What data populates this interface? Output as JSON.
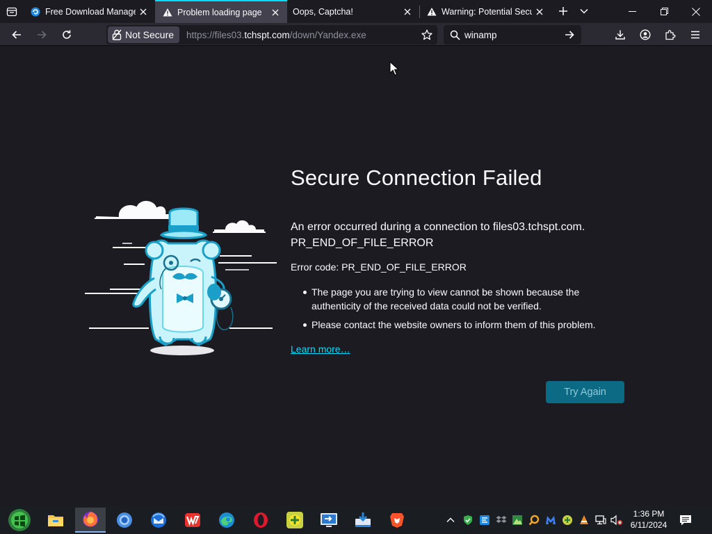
{
  "tabs": [
    {
      "label": "Free Download Manager",
      "icon": "fdm-icon",
      "selected": false
    },
    {
      "label": "Problem loading page",
      "icon": "warning-icon",
      "selected": true
    },
    {
      "label": "Oops, Captcha!",
      "icon": "none",
      "selected": false
    },
    {
      "label": "Warning: Potential Securi",
      "icon": "warning-icon",
      "selected": false
    }
  ],
  "navbar": {
    "security_label": "Not Secure",
    "url_prefix": "https://files03.",
    "url_host": "tchspt.com",
    "url_path": "/down/Yandex.exe",
    "search_value": "winamp"
  },
  "error_page": {
    "title": "Secure Connection Failed",
    "short_desc_line1": "An error occurred during a connection to files03.tchspt.com.",
    "short_desc_line2": "PR_END_OF_FILE_ERROR",
    "error_code": "Error code: PR_END_OF_FILE_ERROR",
    "reasons": [
      "The page you are trying to view cannot be shown because the authenticity of the received data could not be verified.",
      "Please contact the website owners to inform them of this problem."
    ],
    "learn_more": "Learn more…",
    "try_again": "Try Again"
  },
  "taskbar": {
    "apps": [
      "start-icon",
      "file-explorer-icon",
      "firefox-icon",
      "chromium-icon",
      "thunderbird-icon",
      "wps-office-icon",
      "edge-icon",
      "opera-icon",
      "game-icon",
      "remote-desktop-icon",
      "downloader-icon",
      "brave-icon"
    ],
    "active_app": "firefox-icon",
    "time": "1:36 PM",
    "date": "6/11/2024"
  },
  "colors": {
    "accent": "#00ddff",
    "page_bg": "#1c1b22",
    "toolbar_bg": "#2b2a33",
    "button_bg": "#0d6a84"
  }
}
